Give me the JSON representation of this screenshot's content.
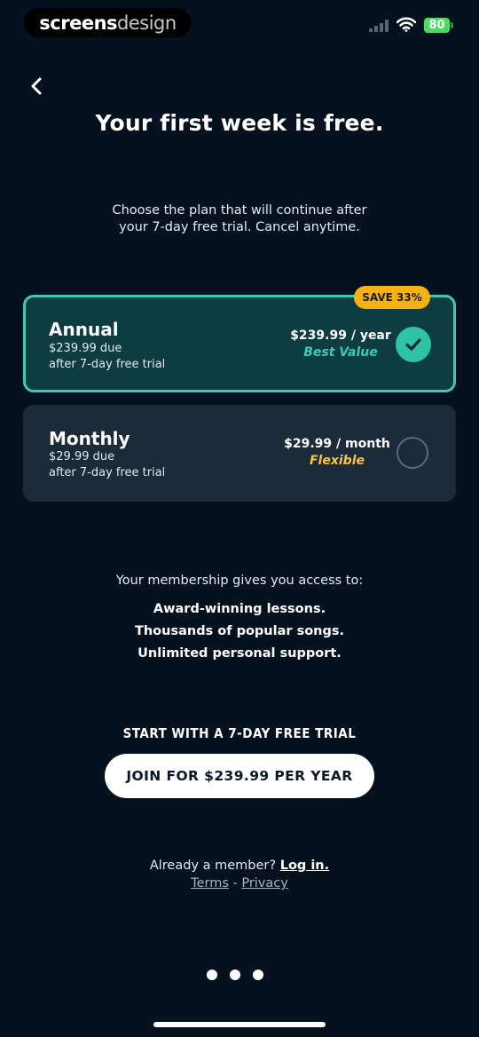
{
  "status_bar": {
    "brand_part1": "screens",
    "brand_part2": "design",
    "battery": "80"
  },
  "header": {
    "title": "Your first week is free.",
    "subtitle_line1": "Choose the plan that will continue after",
    "subtitle_line2": "your 7-day free trial. Cancel anytime."
  },
  "plans": [
    {
      "name": "Annual",
      "due": "$239.99 due",
      "trial": "after 7-day free trial",
      "price": "$239.99 / year",
      "tag": "Best Value",
      "badge": "SAVE 33%",
      "selected": true,
      "tag_color": "#3ec9b3"
    },
    {
      "name": "Monthly",
      "due": "$29.99 due",
      "trial": "after 7-day free trial",
      "price": "$29.99 / month",
      "tag": "Flexible",
      "selected": false,
      "tag_color": "#f6c344"
    }
  ],
  "membership": {
    "heading": "Your membership gives you access to:",
    "benefits": [
      "Award-winning lessons.",
      "Thousands of popular songs.",
      "Unlimited personal support."
    ]
  },
  "cta": {
    "heading": "START WITH A 7-DAY FREE TRIAL",
    "button_label": "JOIN FOR $239.99 PER YEAR"
  },
  "footer": {
    "member_text": "Already a member?",
    "login_label": "Log in.",
    "terms_label": "Terms",
    "separator": "-",
    "privacy_label": "Privacy"
  },
  "colors": {
    "background": "#05111f",
    "accent": "#3ec9b3",
    "badge": "#f6b112"
  },
  "icons": {
    "back": "chevron-left-icon",
    "selected": "checkmark-icon"
  }
}
